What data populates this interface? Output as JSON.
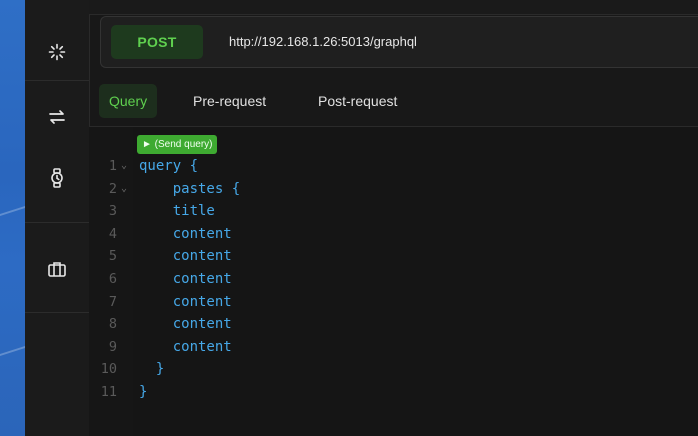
{
  "sidebar": {
    "items": [
      {
        "icon": "sparkle-icon"
      },
      {
        "icon": "swap-icon"
      },
      {
        "icon": "watch-icon"
      },
      {
        "icon": "briefcase-icon"
      }
    ]
  },
  "request": {
    "method": "POST",
    "url": "http://192.168.1.26:5013/graphql",
    "method_color": "#5fd04f"
  },
  "tabs": [
    {
      "label": "Query",
      "active": true
    },
    {
      "label": "Pre-request",
      "active": false
    },
    {
      "label": "Post-request",
      "active": false
    }
  ],
  "editor": {
    "send_label": "► (Send query)",
    "lines": [
      {
        "num": "1",
        "text": "query {",
        "fold": true
      },
      {
        "num": "2",
        "text": "    pastes {",
        "fold": true
      },
      {
        "num": "3",
        "text": "    title",
        "fold": false
      },
      {
        "num": "4",
        "text": "    content",
        "fold": false
      },
      {
        "num": "5",
        "text": "    content",
        "fold": false
      },
      {
        "num": "6",
        "text": "    content",
        "fold": false
      },
      {
        "num": "7",
        "text": "    content",
        "fold": false
      },
      {
        "num": "8",
        "text": "    content",
        "fold": false
      },
      {
        "num": "9",
        "text": "    content",
        "fold": false
      },
      {
        "num": "10",
        "text": "  }",
        "fold": false
      },
      {
        "num": "11",
        "text": "}",
        "fold": false
      }
    ],
    "fold_glyph": "⌄"
  }
}
